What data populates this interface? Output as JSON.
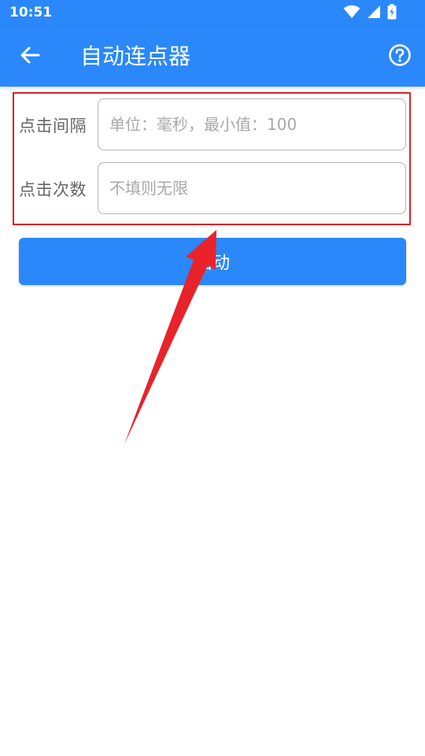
{
  "status_bar": {
    "time": "10:51",
    "icons": [
      "wifi-icon",
      "signal-icon",
      "battery-charging-icon"
    ]
  },
  "app_bar": {
    "back_icon": "arrow-back-icon",
    "title": "自动连点器",
    "help_icon": "help-circle-icon",
    "background_color": "#2a88fa"
  },
  "form": {
    "interval": {
      "label": "点击间隔",
      "value": "",
      "placeholder": "单位：毫秒，最小值：100"
    },
    "count": {
      "label": "点击次数",
      "value": "",
      "placeholder": "不填则无限"
    }
  },
  "start_button": {
    "label": "启动",
    "color": "#2a88fa"
  },
  "annotation": {
    "highlight_color": "#d8232a"
  }
}
